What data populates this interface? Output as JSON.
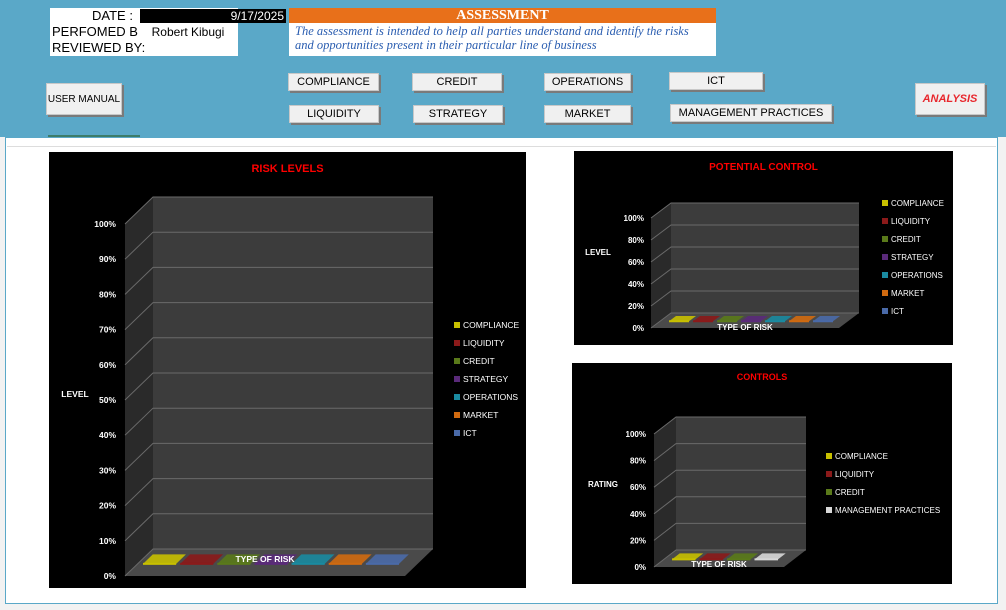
{
  "header": {
    "date_label": "DATE :",
    "date_value": "9/17/2025",
    "performed_label": "PERFOMED B",
    "performed_value": "Robert Kibugi",
    "reviewed_label": "REVIEWED BY:"
  },
  "assessment": {
    "title": "ASSESSMENT",
    "text": "The assessment is intended to help all parties understand and identify the risks and opportunities present in their particular line of business"
  },
  "buttons": {
    "user_manual": "USER MANUAL",
    "compliance": "COMPLIANCE",
    "credit": "CREDIT",
    "operations": "OPERATIONS",
    "ict": "ICT",
    "liquidity": "LIQUIDITY",
    "strategy": "STRATEGY",
    "market": "MARKET",
    "management_practices": "MANAGEMENT PRACTICES",
    "analysis": "ANALYSIS"
  },
  "colors": {
    "band": "#5aa8c8",
    "title_red": "#ff0000",
    "analysis_red": "#e8262c",
    "banner_orange": "#e8701a"
  },
  "chart_data": [
    {
      "type": "bar",
      "title": "RISK LEVELS",
      "xlabel": "TYPE OF RISK",
      "ylabel": "LEVEL",
      "ylim": [
        0,
        100
      ],
      "yticks": [
        "0%",
        "10%",
        "20%",
        "30%",
        "40%",
        "50%",
        "60%",
        "70%",
        "80%",
        "90%",
        "100%"
      ],
      "legend_position": "right",
      "series": [
        {
          "name": "COMPLIANCE",
          "value": 0,
          "color": "#c8c000"
        },
        {
          "name": "LIQUIDITY",
          "value": 0,
          "color": "#8b1a1a"
        },
        {
          "name": "CREDIT",
          "value": 0,
          "color": "#5a7a1a"
        },
        {
          "name": "STRATEGY",
          "value": 0,
          "color": "#5a2a7a"
        },
        {
          "name": "OPERATIONS",
          "value": 0,
          "color": "#1a8aa0"
        },
        {
          "name": "MARKET",
          "value": 0,
          "color": "#d06a10"
        },
        {
          "name": "ICT",
          "value": 0,
          "color": "#4a6aa8"
        }
      ]
    },
    {
      "type": "bar",
      "title": "POTENTIAL CONTROL",
      "xlabel": "TYPE OF RISK",
      "ylabel": "LEVEL",
      "ylim": [
        0,
        100
      ],
      "yticks": [
        "0%",
        "20%",
        "40%",
        "60%",
        "80%",
        "100%"
      ],
      "legend_position": "right",
      "series": [
        {
          "name": "COMPLIANCE",
          "value": 0,
          "color": "#c8c000"
        },
        {
          "name": "LIQUIDITY",
          "value": 0,
          "color": "#8b1a1a"
        },
        {
          "name": "CREDIT",
          "value": 0,
          "color": "#5a7a1a"
        },
        {
          "name": "STRATEGY",
          "value": 0,
          "color": "#5a2a7a"
        },
        {
          "name": "OPERATIONS",
          "value": 0,
          "color": "#1a8aa0"
        },
        {
          "name": "MARKET",
          "value": 0,
          "color": "#d06a10"
        },
        {
          "name": "ICT",
          "value": 0,
          "color": "#4a6aa8"
        }
      ]
    },
    {
      "type": "bar",
      "title": "CONTROLS",
      "xlabel": "TYPE OF RISK",
      "ylabel": "RATING",
      "ylim": [
        0,
        100
      ],
      "yticks": [
        "0%",
        "20%",
        "40%",
        "60%",
        "80%",
        "100%"
      ],
      "legend_position": "right",
      "series": [
        {
          "name": "COMPLIANCE",
          "value": 0,
          "color": "#c8c000"
        },
        {
          "name": "LIQUIDITY",
          "value": 0,
          "color": "#8b1a1a"
        },
        {
          "name": "CREDIT",
          "value": 0,
          "color": "#5a7a1a"
        },
        {
          "name": "MANAGEMENT PRACTICES",
          "value": 0,
          "color": "#d8d8d8"
        }
      ]
    }
  ]
}
